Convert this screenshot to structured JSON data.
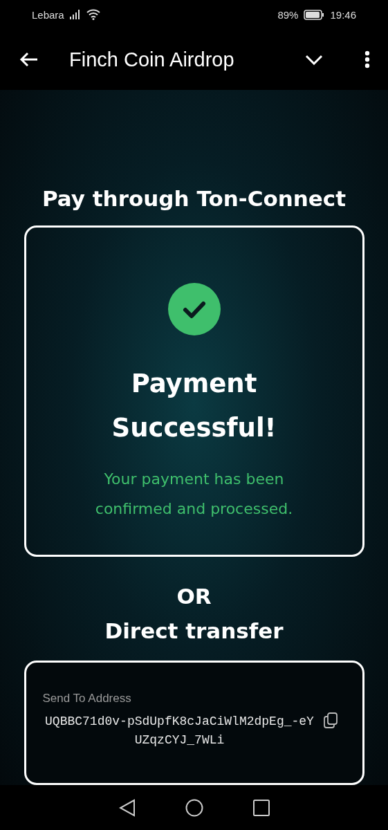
{
  "status_bar": {
    "carrier": "Lebara",
    "battery": "89%",
    "time": "19:46"
  },
  "app_bar": {
    "title": "Finch Coin Airdrop"
  },
  "ton_connect": {
    "heading": "Pay through Ton-Connect",
    "status_title": "Payment Successful!",
    "status_message": "Your payment has been confirmed and processed."
  },
  "divider_text": "OR",
  "direct_transfer": {
    "heading": "Direct transfer",
    "address_label": "Send To Address",
    "address": "UQBBC71d0v-pSdUpfK8cJaCiWlM2dpEg_-eYUZqzCYJ_7WLi"
  }
}
